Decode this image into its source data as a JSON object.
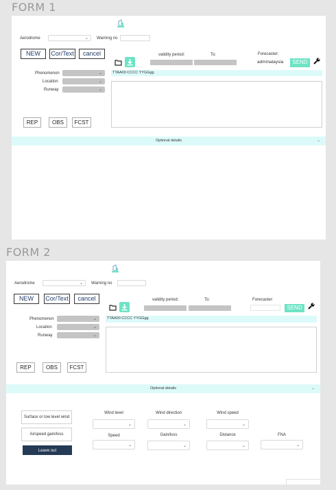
{
  "form1": {
    "title": "FORM 1",
    "aerodrome_label": "Aerodrome",
    "warning_label": "Warning no",
    "buttons": {
      "new": "NEW",
      "cor": "Cor/Text",
      "cancel": "cancel"
    },
    "phenomenon_label": "Phenomenon",
    "location_label": "Location",
    "runway_label": "Runway",
    "validity_label": "validity period:",
    "to_label": "To:",
    "forecaster_label": "Forecaster:",
    "forecaster_value": "admmalaysia",
    "send_label": "SEND",
    "message_text": "TTAA00 CCCC YYGGgg",
    "rep_label": "REP",
    "obs_label": "OBS",
    "fcst_label": "FCST",
    "optional_label": "Optional details"
  },
  "form2": {
    "title": "FORM 2",
    "aerodrome_label": "Aerodrome",
    "warning_label": "Warning no",
    "buttons": {
      "new": "NEW",
      "cor": "Cor/Text",
      "cancel": "cancel"
    },
    "phenomenon_label": "Phenomenon",
    "location_label": "Location",
    "runway_label": "Runway",
    "validity_label": "validity period:",
    "to_label": "To:",
    "forecaster_label": "Forecaster:",
    "forecaster_value": "",
    "send_label": "SEND",
    "message_text": "TTAA00 CCCC YYGGgg",
    "rep_label": "REP",
    "obs_label": "OBS",
    "fcst_label": "FCST",
    "optional_label": "Optional details",
    "optional": {
      "surface_wind_label": "Surface or low level wind",
      "airspeed_label": "Airspeed gain/loss",
      "leave_out_label": "Leave out",
      "wind_level_label": "Wind level",
      "wind_direction_label": "Wind direction",
      "wind_speed_label": "Wind speed",
      "speed_label": "Speed",
      "gain_loss_label": "Gain/loss",
      "distance_label": "Distance",
      "fna_label": "FNA"
    }
  },
  "icons": {
    "logo": "logo-icon",
    "folder": "folder-icon",
    "download": "download-icon",
    "wrench": "wrench-icon",
    "chevron": "chevron-down-icon"
  },
  "colors": {
    "accent": "#6de3c5",
    "info_bar": "#ddfafa",
    "dark_button": "#243a55",
    "disabled": "#c4c4c4",
    "background": "#e6e6e6"
  }
}
